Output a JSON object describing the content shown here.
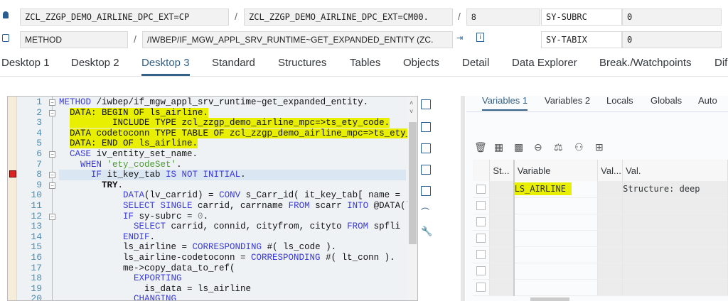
{
  "header": {
    "row1": {
      "program": "ZCL_ZZGP_DEMO_AIRLINE_DPC_EXT=CP",
      "include": "ZCL_ZZGP_DEMO_AIRLINE_DPC_EXT=CM00.",
      "line": "8",
      "sysfield": "SY-SUBRC",
      "sysvalue": "0"
    },
    "row2": {
      "type": "METHOD",
      "name": "/IWBEP/IF_MGW_APPL_SRV_RUNTIME~GET_EXPANDED_ENTITY (ZC.",
      "sysfield": "SY-TABIX",
      "sysvalue": "0"
    },
    "separator": "/"
  },
  "tabs": [
    "Desktop 1",
    "Desktop 2",
    "Desktop 3",
    "Standard",
    "Structures",
    "Tables",
    "Objects",
    "Detail",
    "Data Explorer",
    "Break./Watchpoints",
    "Dif"
  ],
  "active_tab": "Desktop 3",
  "code": {
    "current_line": 8,
    "lines": [
      [
        [
          "METHOD",
          "kw"
        ],
        [
          " /iwbep/if_mgw_appl_srv_runtime~get_expanded_entity.",
          ""
        ]
      ],
      [
        [
          "  ",
          ""
        ],
        [
          "DATA: BEGIN OF ls_airline.",
          "hl"
        ]
      ],
      [
        [
          "  ",
          ""
        ],
        [
          "        INCLUDE TYPE zcl_zzgp_demo_airline_mpc=>ts_ety_code.",
          "hl"
        ]
      ],
      [
        [
          "  ",
          ""
        ],
        [
          "DATA codetoconn TYPE TABLE OF zcl_zzgp_demo_airline_mpc=>ts_ety_conn.",
          "hl"
        ]
      ],
      [
        [
          "  ",
          ""
        ],
        [
          "DATA: END OF ls_airline.",
          "hl"
        ]
      ],
      [
        [
          "  ",
          ""
        ],
        [
          "CASE",
          "kw"
        ],
        [
          " iv_entity_set_name.",
          ""
        ]
      ],
      [
        [
          "    ",
          ""
        ],
        [
          "WHEN",
          "kw"
        ],
        [
          " ",
          ""
        ],
        [
          "'ety_codeSet'",
          "st"
        ],
        [
          ".",
          ""
        ]
      ],
      [
        [
          "      ",
          ""
        ],
        [
          "IF",
          "kw"
        ],
        [
          " it_key_tab ",
          ""
        ],
        [
          "IS NOT INITIAL",
          "kw"
        ],
        [
          ".",
          ""
        ]
      ],
      [
        [
          "        ",
          ""
        ],
        [
          "TRY",
          "bd"
        ],
        [
          ".",
          ""
        ]
      ],
      [
        [
          "            ",
          ""
        ],
        [
          "DATA",
          "kw"
        ],
        [
          "(lv_carrid) = ",
          ""
        ],
        [
          "CONV",
          "kw"
        ],
        [
          " s_Carr_id( it_key_tab[ name = 'Carrid' ]",
          ""
        ]
      ],
      [
        [
          "            ",
          ""
        ],
        [
          "SELECT SINGLE",
          "kw"
        ],
        [
          " carrid, carrname ",
          ""
        ],
        [
          "FROM",
          "kw"
        ],
        [
          " scarr ",
          ""
        ],
        [
          "INTO",
          "kw"
        ],
        [
          " @DATA(ls_code)",
          ""
        ]
      ],
      [
        [
          "            ",
          ""
        ],
        [
          "IF",
          "kw"
        ],
        [
          " sy-subrc = ",
          ""
        ],
        [
          "0",
          "op"
        ],
        [
          ".",
          ""
        ]
      ],
      [
        [
          "              ",
          ""
        ],
        [
          "SELECT",
          "kw"
        ],
        [
          " carrid, connid, cityfrom, cityto ",
          ""
        ],
        [
          "FROM",
          "kw"
        ],
        [
          " spfli",
          ""
        ]
      ],
      [
        [
          "            ",
          ""
        ],
        [
          "ENDIF",
          "kw"
        ],
        [
          ".",
          ""
        ]
      ],
      [
        [
          "            ls_airline = ",
          ""
        ],
        [
          "CORRESPONDING",
          "kw"
        ],
        [
          " #( ls_code ).",
          ""
        ]
      ],
      [
        [
          "            ls_airline-codetoconn = ",
          ""
        ],
        [
          "CORRESPONDING",
          "kw"
        ],
        [
          " #( lt_conn ).",
          ""
        ]
      ],
      [
        [
          "            me->copy_data_to_ref(",
          ""
        ]
      ],
      [
        [
          "              ",
          ""
        ],
        [
          "EXPORTING",
          "kw"
        ]
      ],
      [
        [
          "                is_data = ls_airline",
          ""
        ]
      ],
      [
        [
          "              ",
          ""
        ],
        [
          "CHANGING",
          "kw"
        ]
      ]
    ],
    "folds": [
      1,
      2,
      6,
      8,
      9,
      12
    ]
  },
  "variables": {
    "tabs": [
      "Variables 1",
      "Variables 2",
      "Locals",
      "Globals",
      "Auto"
    ],
    "active_tab": "Variables 1",
    "columns": [
      "St...",
      "Variable",
      "Val...",
      "Val."
    ],
    "rows": [
      {
        "variable": "LS_AIRLINE",
        "value": "Structure: deep"
      },
      {},
      {},
      {},
      {},
      {},
      {}
    ]
  },
  "colors": {
    "accent": "#346187",
    "highlight": "#e8ef00",
    "keyword": "#3a3ad8"
  }
}
